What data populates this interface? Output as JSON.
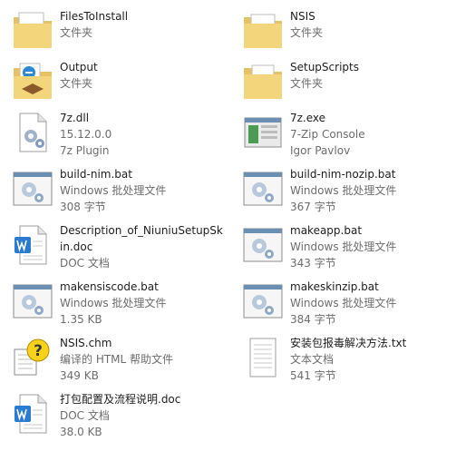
{
  "items": [
    {
      "name": "FilesToInstall",
      "line2": "文件夹",
      "line3": "",
      "icon": "folder-icon"
    },
    {
      "name": "NSIS",
      "line2": "文件夹",
      "line3": "",
      "icon": "folder-icon"
    },
    {
      "name": "Output",
      "line2": "文件夹",
      "line3": "",
      "icon": "folder-icon"
    },
    {
      "name": "SetupScripts",
      "line2": "文件夹",
      "line3": "",
      "icon": "folder-icon"
    },
    {
      "name": "7z.dll",
      "line2": "15.12.0.0",
      "line3": "7z Plugin",
      "icon": "dll-icon"
    },
    {
      "name": "7z.exe",
      "line2": "7-Zip Console",
      "line3": "Igor Pavlov",
      "icon": "exe-icon"
    },
    {
      "name": "build-nim.bat",
      "line2": "Windows 批处理文件",
      "line3": "308 字节",
      "icon": "batch-file-icon"
    },
    {
      "name": "build-nim-nozip.bat",
      "line2": "Windows 批处理文件",
      "line3": "367 字节",
      "icon": "batch-file-icon"
    },
    {
      "name": "Description_of_NiuniuSetupSkin.doc",
      "line2": "DOC 文档",
      "line3": "",
      "icon": "doc-icon"
    },
    {
      "name": "makeapp.bat",
      "line2": "Windows 批处理文件",
      "line3": "343 字节",
      "icon": "batch-file-icon"
    },
    {
      "name": "makensiscode.bat",
      "line2": "Windows 批处理文件",
      "line3": "1.35 KB",
      "icon": "batch-file-icon"
    },
    {
      "name": "makeskinzip.bat",
      "line2": "Windows 批处理文件",
      "line3": "384 字节",
      "icon": "batch-file-icon"
    },
    {
      "name": "NSIS.chm",
      "line2": "编译的 HTML 帮助文件",
      "line3": "349 KB",
      "icon": "chm-help-icon"
    },
    {
      "name": "安装包报毒解决方法.txt",
      "line2": "文本文档",
      "line3": "541 字节",
      "icon": "text-file-icon"
    },
    {
      "name": "打包配置及流程说明.doc",
      "line2": "DOC 文档",
      "line3": "38.0 KB",
      "icon": "doc-icon"
    }
  ]
}
